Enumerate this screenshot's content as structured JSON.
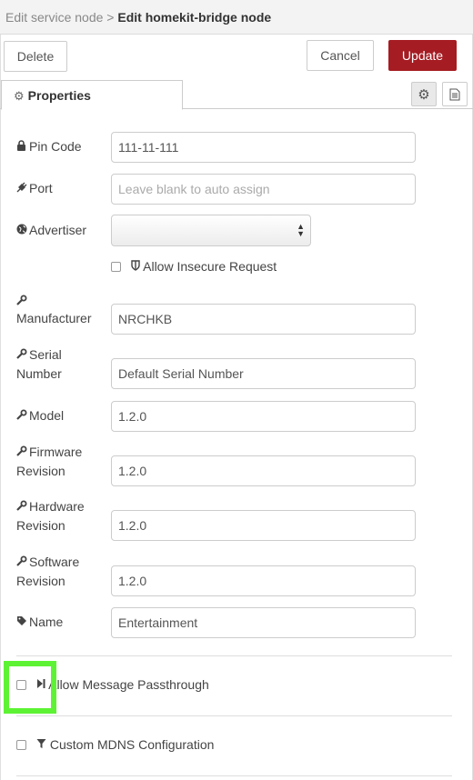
{
  "breadcrumb": {
    "parent": "Edit service node",
    "separator": ">",
    "current": "Edit homekit-bridge node"
  },
  "toolbar": {
    "delete_label": "Delete",
    "cancel_label": "Cancel",
    "update_label": "Update"
  },
  "tabs": {
    "properties_label": "Properties"
  },
  "form": {
    "pin_code": {
      "label": "Pin Code",
      "value": "111-11-111"
    },
    "port": {
      "label": "Port",
      "placeholder": "Leave blank to auto assign"
    },
    "advertiser": {
      "label": "Advertiser",
      "value": ""
    },
    "allow_insecure": {
      "label": "Allow Insecure Request"
    },
    "manufacturer": {
      "label": "Manufacturer",
      "value": "NRCHKB"
    },
    "serial_number": {
      "label_line1": "Serial",
      "label_line2": "Number",
      "value": "Default Serial Number"
    },
    "model": {
      "label": "Model",
      "value": "1.2.0"
    },
    "firmware_revision": {
      "label_line1": "Firmware",
      "label_line2": "Revision",
      "value": "1.2.0"
    },
    "hardware_revision": {
      "label_line1": "Hardware",
      "label_line2": "Revision",
      "value": "1.2.0"
    },
    "software_revision": {
      "label_line1": "Software",
      "label_line2": "Revision",
      "value": "1.2.0"
    },
    "name": {
      "label": "Name",
      "value": "Entertainment"
    }
  },
  "options": {
    "allow_passthrough": {
      "label": "Allow Message Passthrough"
    },
    "custom_mdns": {
      "label": "Custom MDNS Configuration"
    }
  },
  "colors": {
    "update_button": "#a51c22",
    "highlight": "#5df334"
  }
}
